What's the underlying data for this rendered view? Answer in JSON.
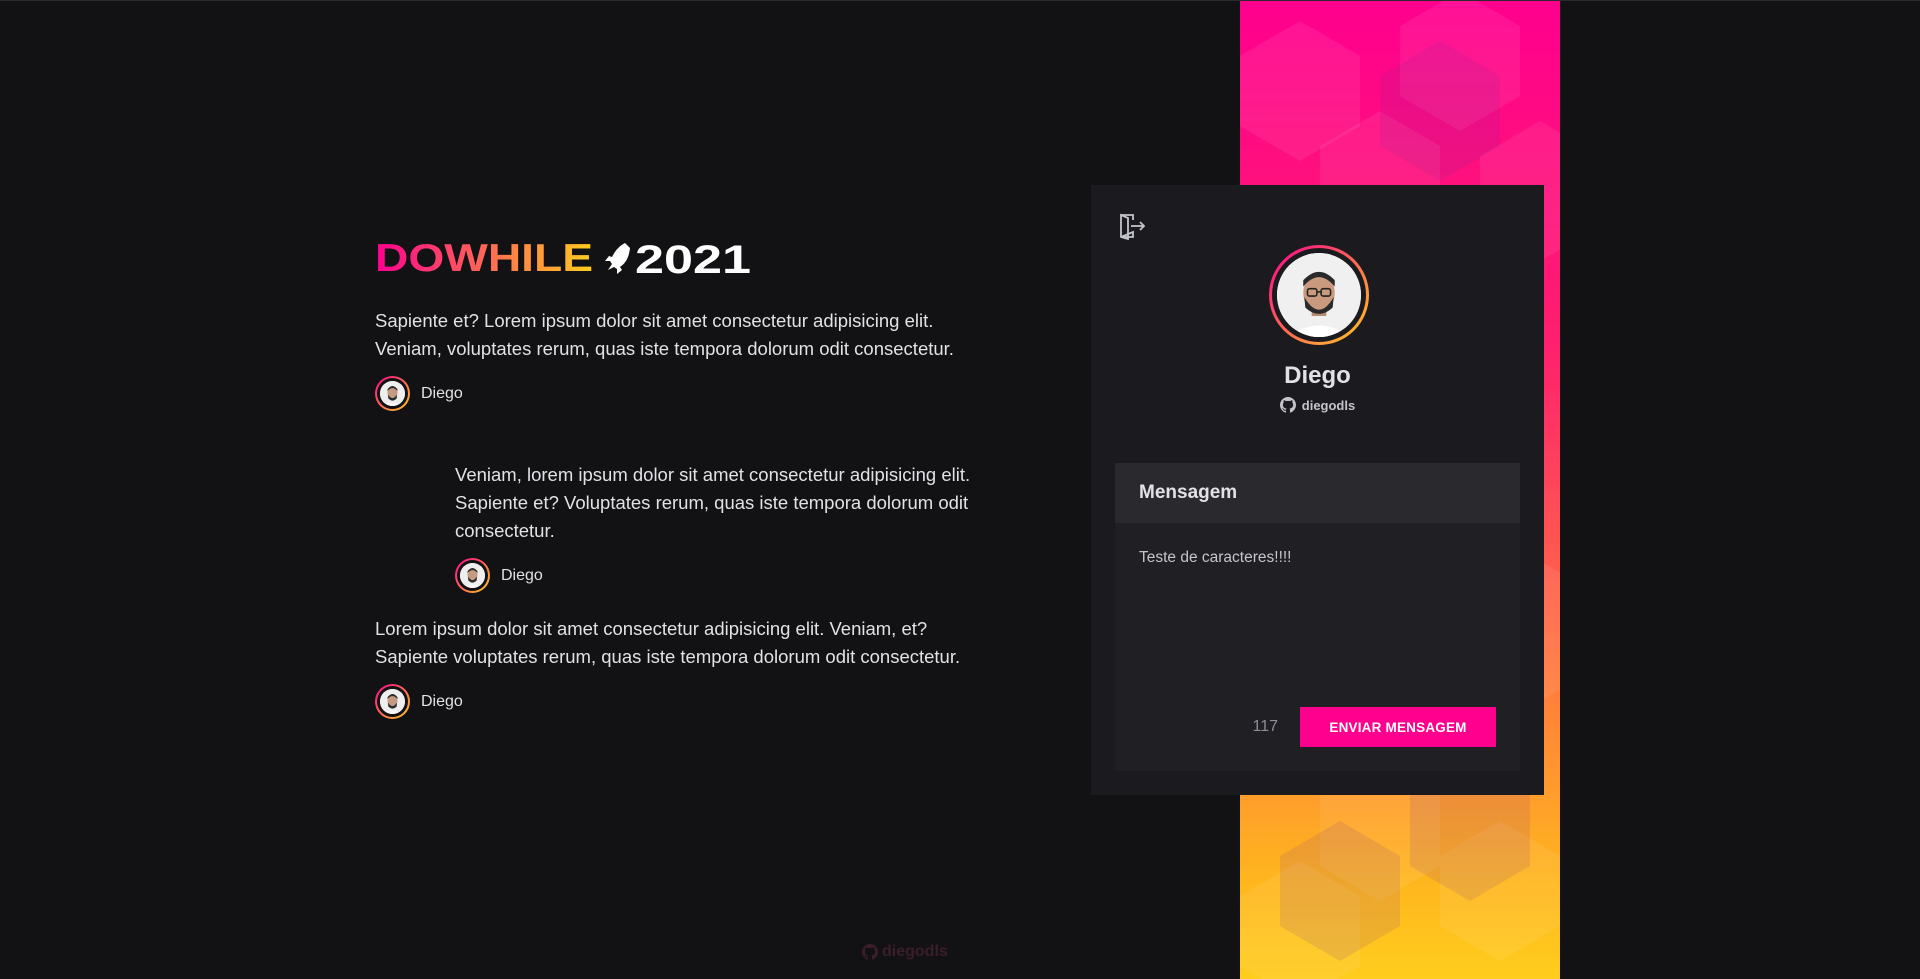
{
  "brand": {
    "logo_text_colored": "DOWHILE",
    "logo_year": "2021",
    "gradient_start": "#ff008e",
    "gradient_end": "#ffcd1e"
  },
  "messages": [
    {
      "text": "Sapiente et? Lorem ipsum dolor sit amet consectetur adipisicing elit. Veniam, voluptates rerum, quas iste tempora dolorum odit consectetur.",
      "user": "Diego"
    },
    {
      "text": "Veniam, lorem ipsum dolor sit amet consectetur adipisicing elit. Sapiente et? Voluptates rerum, quas iste tempora dolorum odit consectetur.",
      "user": "Diego"
    },
    {
      "text": "Lorem ipsum dolor sit amet consectetur adipisicing elit. Veniam, et? Sapiente voluptates rerum, quas iste tempora dolorum odit consectetur.",
      "user": "Diego"
    }
  ],
  "profile": {
    "name": "Diego",
    "login": "diegodls",
    "signout_icon": "sign-out-icon"
  },
  "form": {
    "title": "Mensagem",
    "message_value": "Teste de caracteres!!!!",
    "counter": "117",
    "submit_label": "ENVIAR MENSAGEM",
    "accent": "#ff008e"
  },
  "footer": {
    "link_text": "diegodls",
    "icon": "github-icon"
  }
}
